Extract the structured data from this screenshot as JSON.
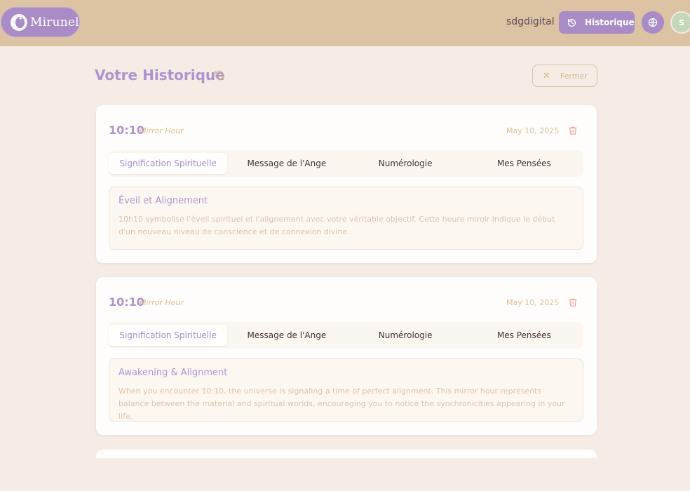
{
  "header": {
    "logo_text": "Mirunel",
    "username": "sdgdigital",
    "history_button": "Historique",
    "avatar_initial": "S",
    "colors": {
      "bar": "#dcc3a4",
      "accent": "#a98cc6"
    }
  },
  "page": {
    "title": "Votre Historique",
    "close_label": "Fermer"
  },
  "entries": [
    {
      "time": "10:10",
      "type": "Mirror Hour",
      "date": "May 10, 2025",
      "tabs": [
        "Signification Spirituelle",
        "Message de l'Ange",
        "Numérologie",
        "Mes Pensées"
      ],
      "active_tab": "Signification Spirituelle",
      "content_title": "Éveil et Alignement",
      "content_body": "10h10 symbolise l'éveil spirituel et l'alignement avec votre véritable objectif. Cette heure miroir indique le début d'un nouveau niveau de conscience et de connexion divine."
    },
    {
      "time": "10:10",
      "type": "Mirror Hour",
      "date": "May 10, 2025",
      "tabs": [
        "Signification Spirituelle",
        "Message de l'Ange",
        "Numérologie",
        "Mes Pensées"
      ],
      "active_tab": "Signification Spirituelle",
      "content_title": "Awakening & Alignment",
      "content_body": "When you encounter 10:10, the universe is signaling a time of perfect alignment. This mirror hour represents balance between the material and spiritual worlds, encouraging you to notice the synchronicities appearing in your life."
    }
  ]
}
